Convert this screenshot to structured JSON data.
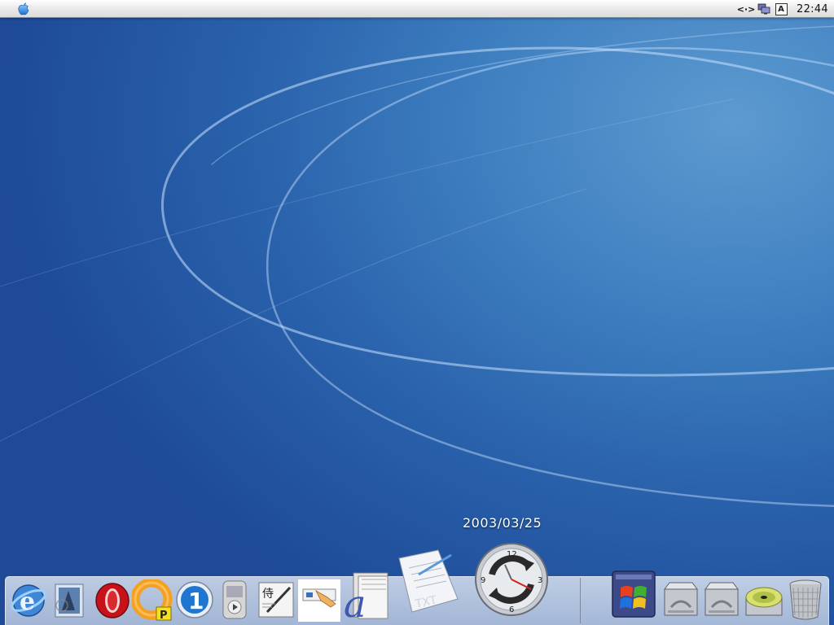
{
  "menubar": {
    "apple_icon": "apple-menu-icon",
    "extras": {
      "network_icon": "network-status-icon",
      "network_glyph": "<·>",
      "displays_icon": "displays-icon",
      "input_menu_letter": "A",
      "clock": "22:44"
    }
  },
  "desktop": {
    "date_overlay": "2003/03/25"
  },
  "dock": {
    "apps": [
      {
        "icon": "internet-explorer-icon"
      },
      {
        "icon": "mail-icon"
      },
      {
        "icon": "opera-icon"
      },
      {
        "icon": "lifebuoy-icon"
      },
      {
        "icon": "onestep-icon"
      },
      {
        "icon": "media-player-icon"
      },
      {
        "icon": "samurai-editor-icon"
      },
      {
        "icon": "installer-icon"
      },
      {
        "icon": "font-book-icon"
      },
      {
        "icon": "text-document-icon"
      },
      {
        "icon": "clock-sync-icon"
      }
    ],
    "others": [
      {
        "icon": "windows-emulator-icon"
      },
      {
        "icon": "hard-drive-icon"
      },
      {
        "icon": "hard-drive-icon"
      },
      {
        "icon": "cd-drive-icon"
      },
      {
        "icon": "trash-icon"
      }
    ]
  },
  "colors": {
    "desktop_blue": "#2a62ac",
    "menubar_bg": "#ececec",
    "apple_blue": "#3a8ee0"
  }
}
